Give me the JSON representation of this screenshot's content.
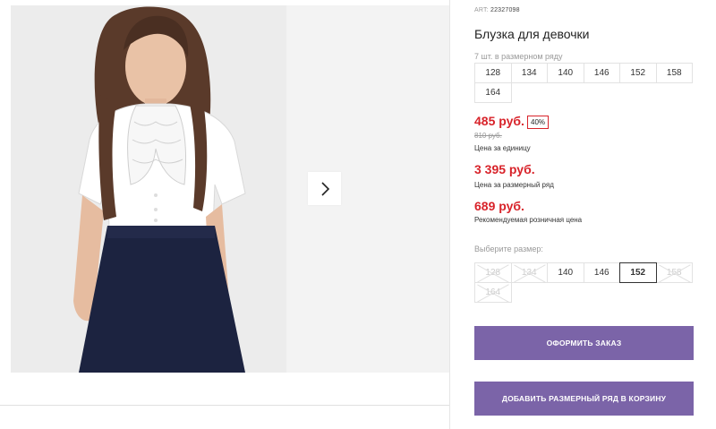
{
  "product": {
    "art_prefix": "ART:",
    "art_number": "22327098",
    "title": "Блузка для девочки",
    "row_count_text": "7 шт. в размерном ряду",
    "sizes_in_row": [
      "128",
      "134",
      "140",
      "146",
      "152",
      "158",
      "164"
    ]
  },
  "prices": {
    "unit_price": "485 руб.",
    "discount": "40%",
    "old_price": "810 руб.",
    "unit_label": "Цена за единицу",
    "row_price": "3 395 руб.",
    "row_label": "Цена за размерный ряд",
    "rrp_price": "689 руб.",
    "rrp_label": "Рекомендуемая розничная цена"
  },
  "size_picker": {
    "label": "Выберите размер:",
    "options": [
      {
        "label": "128",
        "available": false
      },
      {
        "label": "134",
        "available": false
      },
      {
        "label": "140",
        "available": true
      },
      {
        "label": "146",
        "available": true
      },
      {
        "label": "152",
        "available": true,
        "selected": true
      },
      {
        "label": "158",
        "available": false
      },
      {
        "label": "164",
        "available": false
      }
    ]
  },
  "actions": {
    "order_label": "ОФОРМИТЬ ЗАКАЗ",
    "add_row_label": "ДОБАВИТЬ РАЗМЕРНЫЙ РЯД В КОРЗИНУ"
  },
  "colors": {
    "accent_button": "#7b64a8",
    "price_red": "#d8232a"
  },
  "gallery": {
    "next_icon": "chevron-right-icon"
  }
}
